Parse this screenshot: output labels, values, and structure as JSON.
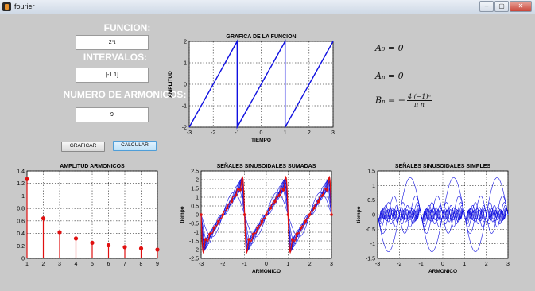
{
  "window": {
    "title": "fourier",
    "buttons": [
      "–",
      "▢",
      "✕"
    ]
  },
  "inputs": {
    "funcion_label": "FUNCION:",
    "funcion_value": "2*t",
    "intervalos_label": "INTERVALOS:",
    "intervalos_value": "[-1 1]",
    "armonicos_label": "NUMERO DE ARMONICOS:",
    "armonicos_value": "9"
  },
  "buttons": {
    "graficar": "GRAFICAR",
    "calcular": "CALCULAR"
  },
  "formulas": {
    "a0": "A₀ = 0",
    "an": "Aₙ = 0",
    "bn_left": "Bₙ = −",
    "bn_num": "4 (−1)ⁿ",
    "bn_den": "π n"
  },
  "colors": {
    "main_line": "#1010e0",
    "stem": "#e01010",
    "overlay": "#e01010"
  },
  "chart_data": [
    {
      "type": "line",
      "title": "GRAFICA DE LA FUNCION",
      "xlabel": "TIEMPO",
      "ylabel": "AMPLITUD",
      "xlim": [
        -3,
        3
      ],
      "ylim": [
        -2,
        2
      ],
      "xticks": [
        -3,
        -2,
        -1,
        0,
        1,
        2,
        3
      ],
      "yticks": [
        -2,
        -1,
        0,
        1,
        2
      ],
      "grid": true,
      "series": [
        {
          "x": [
            -3,
            -1,
            -1,
            1,
            1,
            3
          ],
          "y": [
            -2,
            2,
            -2,
            2,
            -2,
            2
          ]
        }
      ]
    },
    {
      "type": "bar",
      "title": "AMPLITUD ARMONICOS",
      "xlabel": "",
      "ylabel": "",
      "xlim": [
        1,
        9
      ],
      "ylim": [
        0,
        1.4
      ],
      "xticks": [
        1,
        2,
        3,
        4,
        5,
        6,
        7,
        8,
        9
      ],
      "yticks": [
        0,
        0.2,
        0.4,
        0.6,
        0.8,
        1,
        1.2,
        1.4
      ],
      "grid": true,
      "categories": [
        1,
        2,
        3,
        4,
        5,
        6,
        7,
        8,
        9
      ],
      "values": [
        1.27,
        0.64,
        0.42,
        0.32,
        0.25,
        0.21,
        0.18,
        0.16,
        0.14
      ]
    },
    {
      "type": "line",
      "title": "SEÑALES SINUSOIDALES SUMADAS",
      "xlabel": "ARMONICO",
      "ylabel": "tiempo",
      "xlim": [
        -3,
        3
      ],
      "ylim": [
        -2.5,
        2.5
      ],
      "xticks": [
        -3,
        -2,
        -1,
        0,
        1,
        2,
        3
      ],
      "yticks": [
        -2.5,
        -2,
        -1.5,
        -1,
        -0.5,
        0,
        0.5,
        1,
        1.5,
        2,
        2.5
      ],
      "grid": true,
      "partial_sums": [
        1,
        2,
        3,
        4,
        5,
        6,
        7,
        8,
        9
      ],
      "highlighted_partial_sum": 9
    },
    {
      "type": "line",
      "title": "SEÑALES SINUSOIDALES SIMPLES",
      "xlabel": "ARMONICO",
      "ylabel": "tiempo",
      "xlim": [
        -3,
        3
      ],
      "ylim": [
        -1.5,
        1.5
      ],
      "xticks": [
        -3,
        -2,
        -1,
        0,
        1,
        2,
        3
      ],
      "yticks": [
        -1.5,
        -1,
        -0.5,
        0,
        0.5,
        1,
        1.5
      ],
      "grid": true,
      "harmonics": [
        1,
        2,
        3,
        4,
        5,
        6,
        7,
        8,
        9
      ],
      "amplitudes": [
        1.27,
        0.64,
        0.42,
        0.32,
        0.25,
        0.21,
        0.18,
        0.16,
        0.14
      ]
    }
  ]
}
